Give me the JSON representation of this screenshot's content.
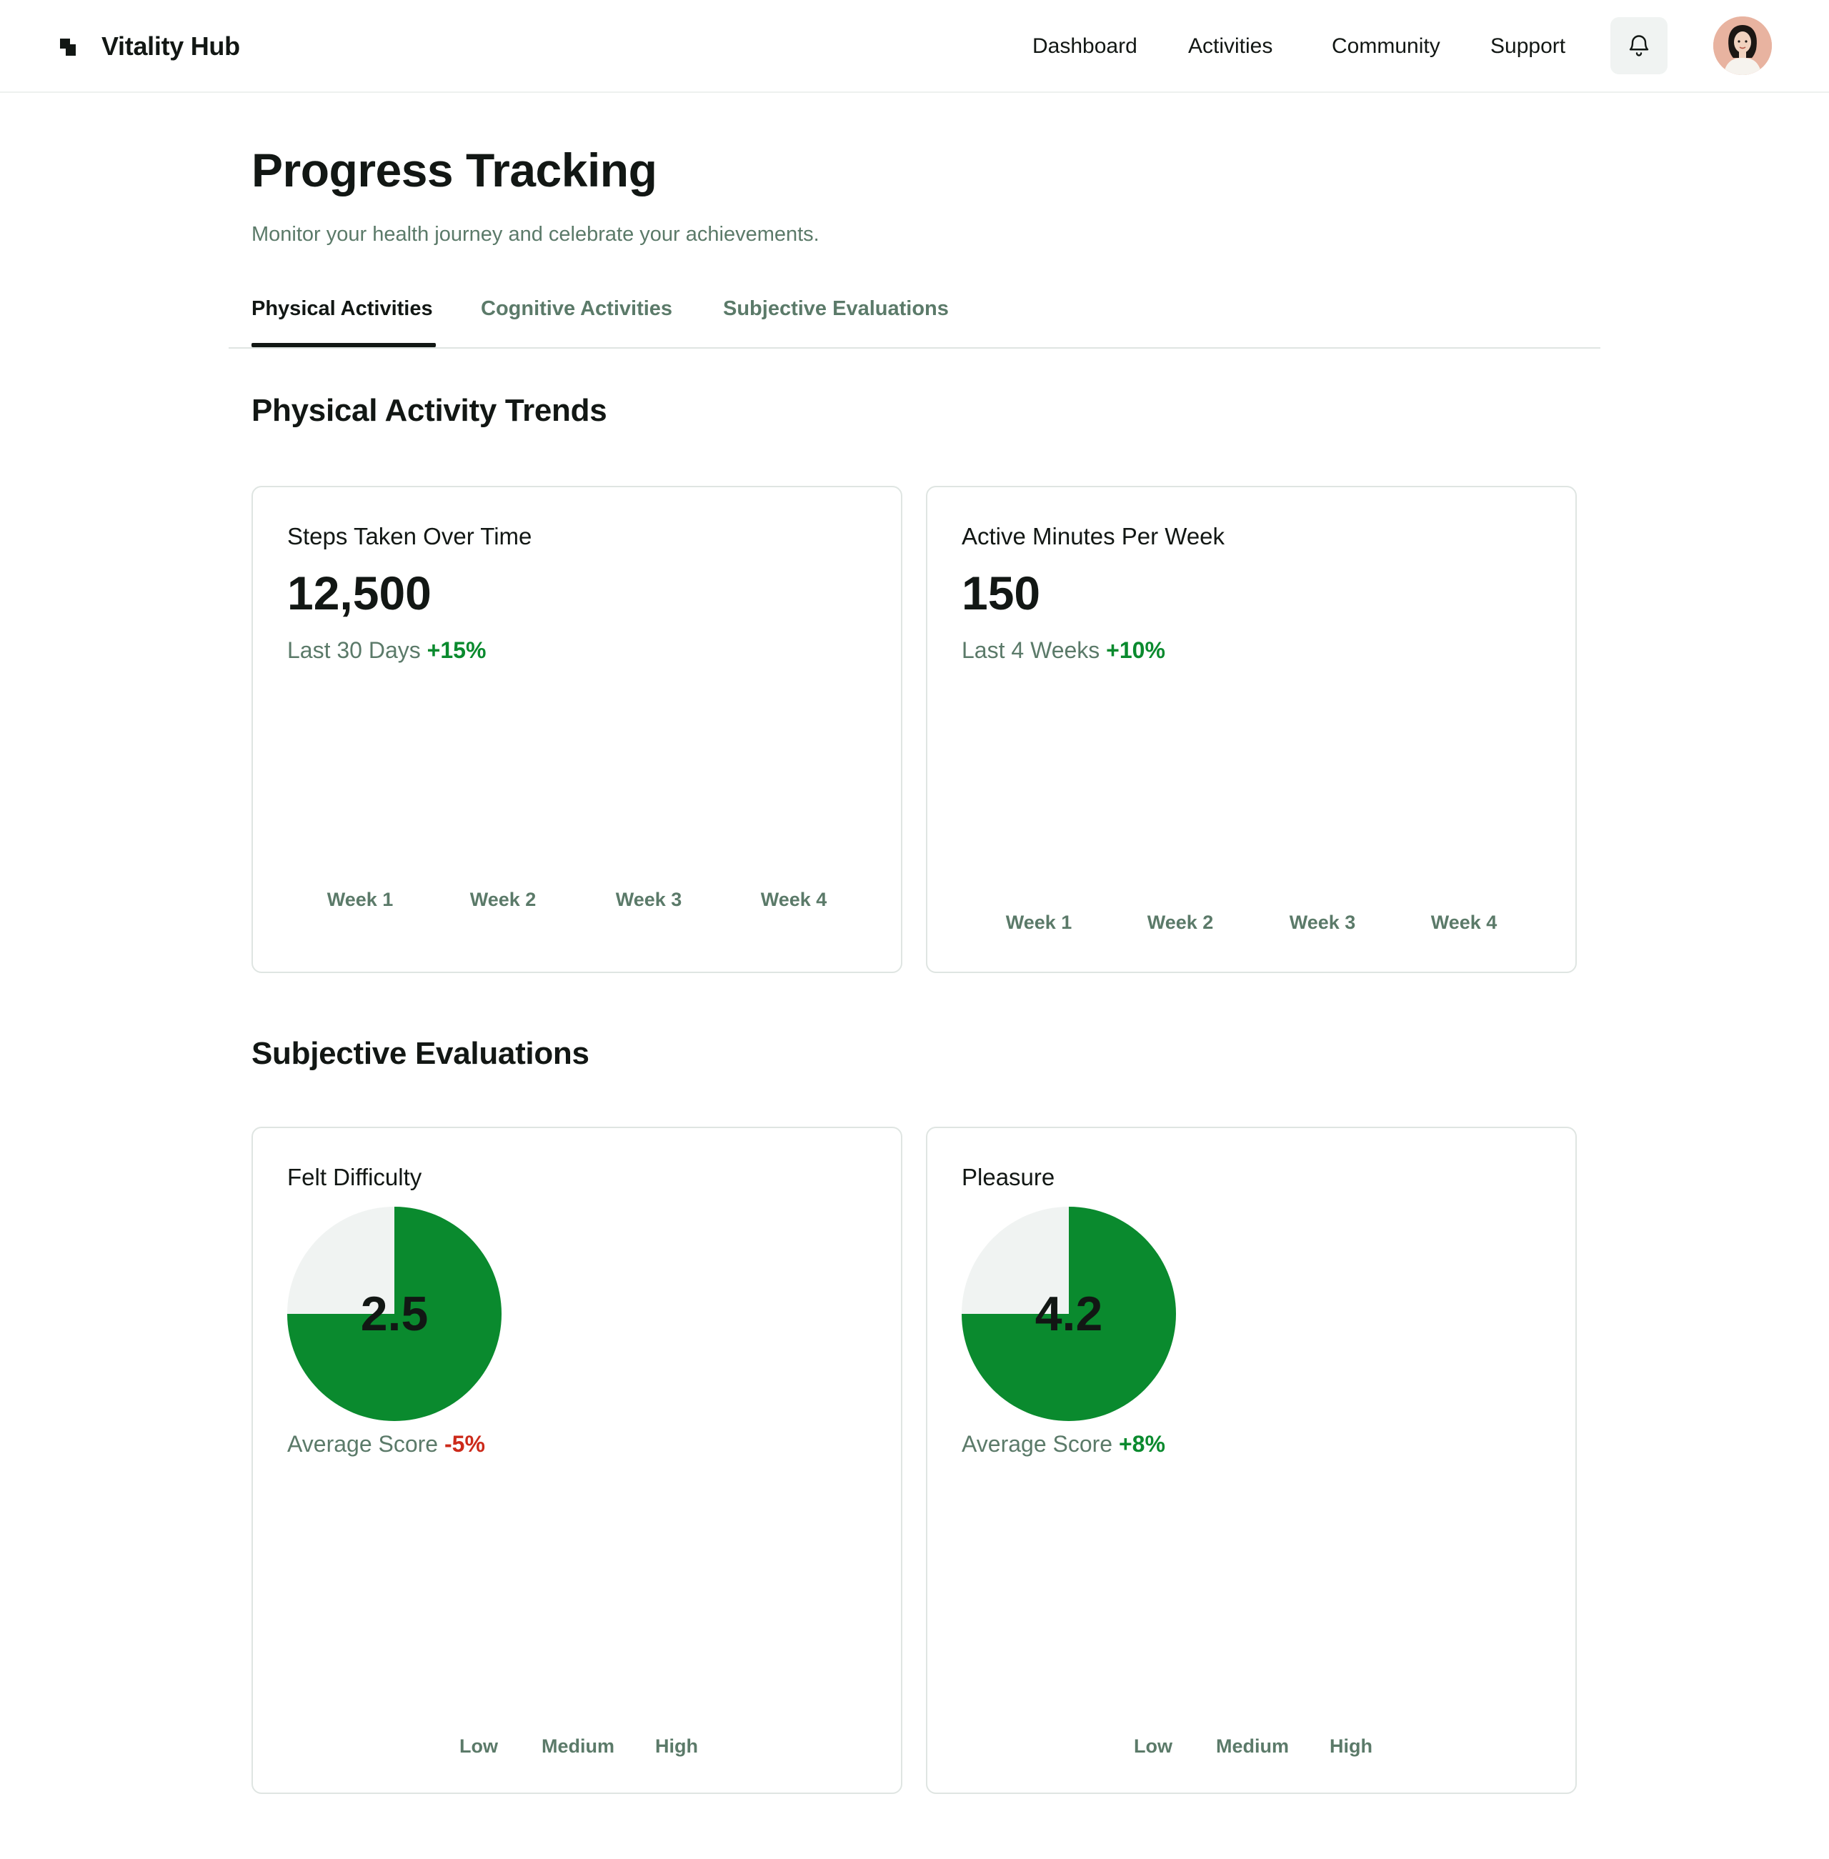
{
  "header": {
    "brand": "Vitality Hub",
    "nav": [
      "Dashboard",
      "Activities",
      "Community",
      "Support"
    ],
    "icons": {
      "logo": "vitality-logo-icon",
      "notifications": "bell-icon",
      "avatar": "user-avatar"
    }
  },
  "page": {
    "title": "Progress Tracking",
    "subtitle": "Monitor your health journey and celebrate your achievements."
  },
  "tabs": [
    {
      "label": "Physical Activities",
      "active": true
    },
    {
      "label": "Cognitive Activities",
      "active": false
    },
    {
      "label": "Subjective Evaluations",
      "active": false
    }
  ],
  "sections": {
    "physical": "Physical Activity Trends",
    "subjective": "Subjective Evaluations"
  },
  "cards": {
    "steps": {
      "title": "Steps Taken Over Time",
      "value": "12,500",
      "period": "Last 30 Days",
      "delta": "+15%",
      "weeks": [
        "Week 1",
        "Week 2",
        "Week 3",
        "Week 4"
      ]
    },
    "active_minutes": {
      "title": "Active Minutes Per Week",
      "value": "150",
      "period": "Last 4 Weeks",
      "delta": "+10%",
      "weeks": [
        "Week 1",
        "Week 2",
        "Week 3",
        "Week 4"
      ]
    },
    "difficulty": {
      "title": "Felt Difficulty",
      "value": "2.5",
      "avg_label": "Average Score",
      "delta": "-5%",
      "levels": [
        "Low",
        "Medium",
        "High"
      ]
    },
    "pleasure": {
      "title": "Pleasure",
      "value": "4.2",
      "avg_label": "Average Score",
      "delta": "+8%",
      "levels": [
        "Low",
        "Medium",
        "High"
      ]
    }
  },
  "colors": {
    "accent": "#0a8a2e",
    "negative": "#cc2a1a",
    "muted_text": "#5b7a69",
    "pie_background": "#f0f3f2"
  }
}
